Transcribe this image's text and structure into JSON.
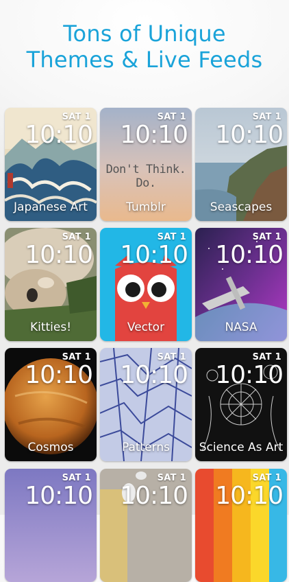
{
  "headline": {
    "line1": "Tons of Unique",
    "line2": "Themes & Live Feeds"
  },
  "clock": {
    "date": "SAT 1",
    "time": "10:10"
  },
  "themes": [
    {
      "label": "Japanese Art"
    },
    {
      "label": "Tumblr",
      "quote": "Don't Think. Do."
    },
    {
      "label": "Seascapes"
    },
    {
      "label": "Kitties!"
    },
    {
      "label": "Vector"
    },
    {
      "label": "NASA"
    },
    {
      "label": "Cosmos"
    },
    {
      "label": "Patterns"
    },
    {
      "label": "Science As Art"
    },
    {
      "label": ""
    },
    {
      "label": ""
    },
    {
      "label": ""
    }
  ],
  "colors": {
    "accent": "#1aa3d9"
  }
}
